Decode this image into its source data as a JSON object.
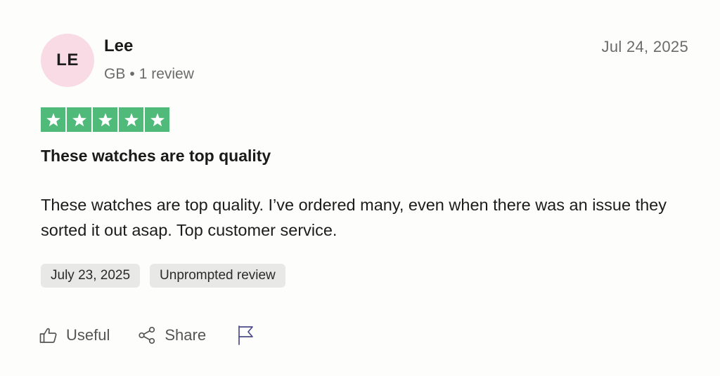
{
  "reviewer": {
    "initials": "LE",
    "name": "Lee",
    "country": "GB",
    "separator": "•",
    "review_count": "1 review",
    "avatar_color": "#f8dbe5"
  },
  "review": {
    "date": "Jul 24, 2025",
    "rating": 5,
    "rating_max": 5,
    "star_color": "#4fba7a",
    "title": "These watches are top quality",
    "body": "These watches are top quality. I’ve ordered many, even when there was an issue they sorted it out asap. Top customer service.",
    "experience_date": "July 23, 2025",
    "review_type": "Unprompted review"
  },
  "actions": {
    "useful_label": "Useful",
    "share_label": "Share",
    "useful_icon": "thumbs-up-icon",
    "share_icon": "share-icon",
    "report_icon": "flag-icon"
  }
}
